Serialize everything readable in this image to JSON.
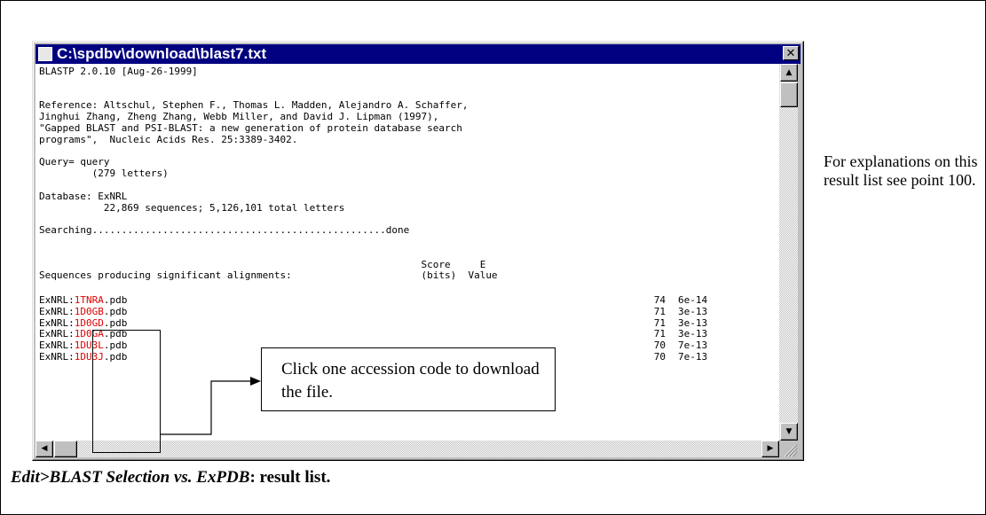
{
  "window": {
    "title": "C:\\spdbv\\download\\blast7.txt",
    "close_glyph": "✕"
  },
  "content": {
    "lines": [
      "BLASTP 2.0.10 [Aug-26-1999]",
      "",
      "",
      "Reference: Altschul, Stephen F., Thomas L. Madden, Alejandro A. Schaffer,",
      "Jinghui Zhang, Zheng Zhang, Webb Miller, and David J. Lipman (1997),",
      "\"Gapped BLAST and PSI-BLAST: a new generation of protein database search",
      "programs\",  Nucleic Acids Res. 25:3389-3402.",
      "",
      "Query= query",
      "         (279 letters)",
      "",
      "Database: ExNRL",
      "           22,869 sequences; 5,126,101 total letters",
      "",
      "Searching..................................................done",
      "",
      "",
      "                                                                 Score     E",
      "Sequences producing significant alignments:                      (bits)  Value"
    ],
    "hits": [
      {
        "prefix": "ExNRL:",
        "accession": "1TNRA",
        "suffix": ".pdb",
        "score": "74",
        "evalue": "6e-14"
      },
      {
        "prefix": "ExNRL:",
        "accession": "1D0GB",
        "suffix": ".pdb",
        "score": "71",
        "evalue": "3e-13"
      },
      {
        "prefix": "ExNRL:",
        "accession": "1D0GD",
        "suffix": ".pdb",
        "score": "71",
        "evalue": "3e-13"
      },
      {
        "prefix": "ExNRL:",
        "accession": "1D0GA",
        "suffix": ".pdb",
        "score": "71",
        "evalue": "3e-13"
      },
      {
        "prefix": "ExNRL:",
        "accession": "1DU3L",
        "suffix": ".pdb",
        "score": "70",
        "evalue": "7e-13"
      },
      {
        "prefix": "ExNRL:",
        "accession": "1DU3J",
        "suffix": ".pdb",
        "score": "70",
        "evalue": "7e-13"
      }
    ]
  },
  "scrollbar": {
    "up": "▲",
    "down": "▼",
    "left": "◀",
    "right": "▶"
  },
  "side_note": "For explanations on this result list see point 100.",
  "callout": "Click one accession code to download the file.",
  "caption": {
    "menu_path": "Edit>BLAST Selection vs. ExPDB",
    "rest": ": result list."
  },
  "colors": {
    "titlebar": "#000080",
    "accession": "#e00000"
  }
}
